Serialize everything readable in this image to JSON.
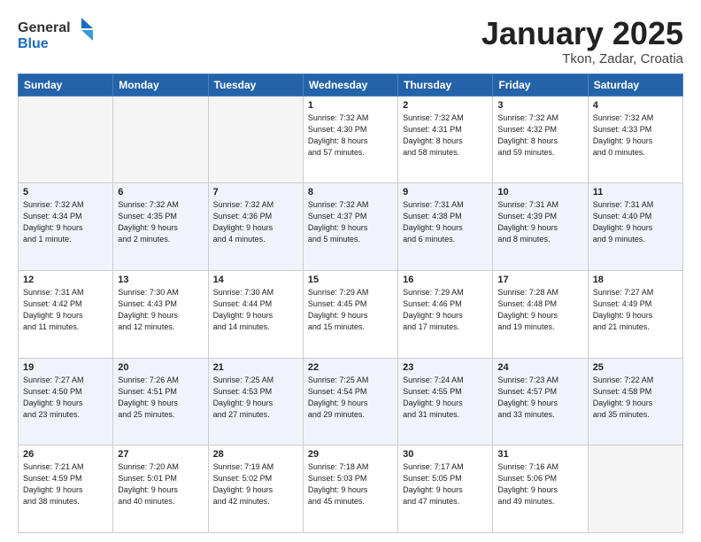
{
  "header": {
    "logo_general": "General",
    "logo_blue": "Blue",
    "month_title": "January 2025",
    "location": "Tkon, Zadar, Croatia"
  },
  "weekdays": [
    "Sunday",
    "Monday",
    "Tuesday",
    "Wednesday",
    "Thursday",
    "Friday",
    "Saturday"
  ],
  "weeks": [
    [
      {
        "day": "",
        "info": "",
        "empty": true
      },
      {
        "day": "",
        "info": "",
        "empty": true
      },
      {
        "day": "",
        "info": "",
        "empty": true
      },
      {
        "day": "1",
        "info": "Sunrise: 7:32 AM\nSunset: 4:30 PM\nDaylight: 8 hours\nand 57 minutes."
      },
      {
        "day": "2",
        "info": "Sunrise: 7:32 AM\nSunset: 4:31 PM\nDaylight: 8 hours\nand 58 minutes."
      },
      {
        "day": "3",
        "info": "Sunrise: 7:32 AM\nSunset: 4:32 PM\nDaylight: 8 hours\nand 59 minutes."
      },
      {
        "day": "4",
        "info": "Sunrise: 7:32 AM\nSunset: 4:33 PM\nDaylight: 9 hours\nand 0 minutes."
      }
    ],
    [
      {
        "day": "5",
        "info": "Sunrise: 7:32 AM\nSunset: 4:34 PM\nDaylight: 9 hours\nand 1 minute."
      },
      {
        "day": "6",
        "info": "Sunrise: 7:32 AM\nSunset: 4:35 PM\nDaylight: 9 hours\nand 2 minutes."
      },
      {
        "day": "7",
        "info": "Sunrise: 7:32 AM\nSunset: 4:36 PM\nDaylight: 9 hours\nand 4 minutes."
      },
      {
        "day": "8",
        "info": "Sunrise: 7:32 AM\nSunset: 4:37 PM\nDaylight: 9 hours\nand 5 minutes."
      },
      {
        "day": "9",
        "info": "Sunrise: 7:31 AM\nSunset: 4:38 PM\nDaylight: 9 hours\nand 6 minutes."
      },
      {
        "day": "10",
        "info": "Sunrise: 7:31 AM\nSunset: 4:39 PM\nDaylight: 9 hours\nand 8 minutes."
      },
      {
        "day": "11",
        "info": "Sunrise: 7:31 AM\nSunset: 4:40 PM\nDaylight: 9 hours\nand 9 minutes."
      }
    ],
    [
      {
        "day": "12",
        "info": "Sunrise: 7:31 AM\nSunset: 4:42 PM\nDaylight: 9 hours\nand 11 minutes."
      },
      {
        "day": "13",
        "info": "Sunrise: 7:30 AM\nSunset: 4:43 PM\nDaylight: 9 hours\nand 12 minutes."
      },
      {
        "day": "14",
        "info": "Sunrise: 7:30 AM\nSunset: 4:44 PM\nDaylight: 9 hours\nand 14 minutes."
      },
      {
        "day": "15",
        "info": "Sunrise: 7:29 AM\nSunset: 4:45 PM\nDaylight: 9 hours\nand 15 minutes."
      },
      {
        "day": "16",
        "info": "Sunrise: 7:29 AM\nSunset: 4:46 PM\nDaylight: 9 hours\nand 17 minutes."
      },
      {
        "day": "17",
        "info": "Sunrise: 7:28 AM\nSunset: 4:48 PM\nDaylight: 9 hours\nand 19 minutes."
      },
      {
        "day": "18",
        "info": "Sunrise: 7:27 AM\nSunset: 4:49 PM\nDaylight: 9 hours\nand 21 minutes."
      }
    ],
    [
      {
        "day": "19",
        "info": "Sunrise: 7:27 AM\nSunset: 4:50 PM\nDaylight: 9 hours\nand 23 minutes."
      },
      {
        "day": "20",
        "info": "Sunrise: 7:26 AM\nSunset: 4:51 PM\nDaylight: 9 hours\nand 25 minutes."
      },
      {
        "day": "21",
        "info": "Sunrise: 7:25 AM\nSunset: 4:53 PM\nDaylight: 9 hours\nand 27 minutes."
      },
      {
        "day": "22",
        "info": "Sunrise: 7:25 AM\nSunset: 4:54 PM\nDaylight: 9 hours\nand 29 minutes."
      },
      {
        "day": "23",
        "info": "Sunrise: 7:24 AM\nSunset: 4:55 PM\nDaylight: 9 hours\nand 31 minutes."
      },
      {
        "day": "24",
        "info": "Sunrise: 7:23 AM\nSunset: 4:57 PM\nDaylight: 9 hours\nand 33 minutes."
      },
      {
        "day": "25",
        "info": "Sunrise: 7:22 AM\nSunset: 4:58 PM\nDaylight: 9 hours\nand 35 minutes."
      }
    ],
    [
      {
        "day": "26",
        "info": "Sunrise: 7:21 AM\nSunset: 4:59 PM\nDaylight: 9 hours\nand 38 minutes."
      },
      {
        "day": "27",
        "info": "Sunrise: 7:20 AM\nSunset: 5:01 PM\nDaylight: 9 hours\nand 40 minutes."
      },
      {
        "day": "28",
        "info": "Sunrise: 7:19 AM\nSunset: 5:02 PM\nDaylight: 9 hours\nand 42 minutes."
      },
      {
        "day": "29",
        "info": "Sunrise: 7:18 AM\nSunset: 5:03 PM\nDaylight: 9 hours\nand 45 minutes."
      },
      {
        "day": "30",
        "info": "Sunrise: 7:17 AM\nSunset: 5:05 PM\nDaylight: 9 hours\nand 47 minutes."
      },
      {
        "day": "31",
        "info": "Sunrise: 7:16 AM\nSunset: 5:06 PM\nDaylight: 9 hours\nand 49 minutes."
      },
      {
        "day": "",
        "info": "",
        "empty": true
      }
    ]
  ]
}
